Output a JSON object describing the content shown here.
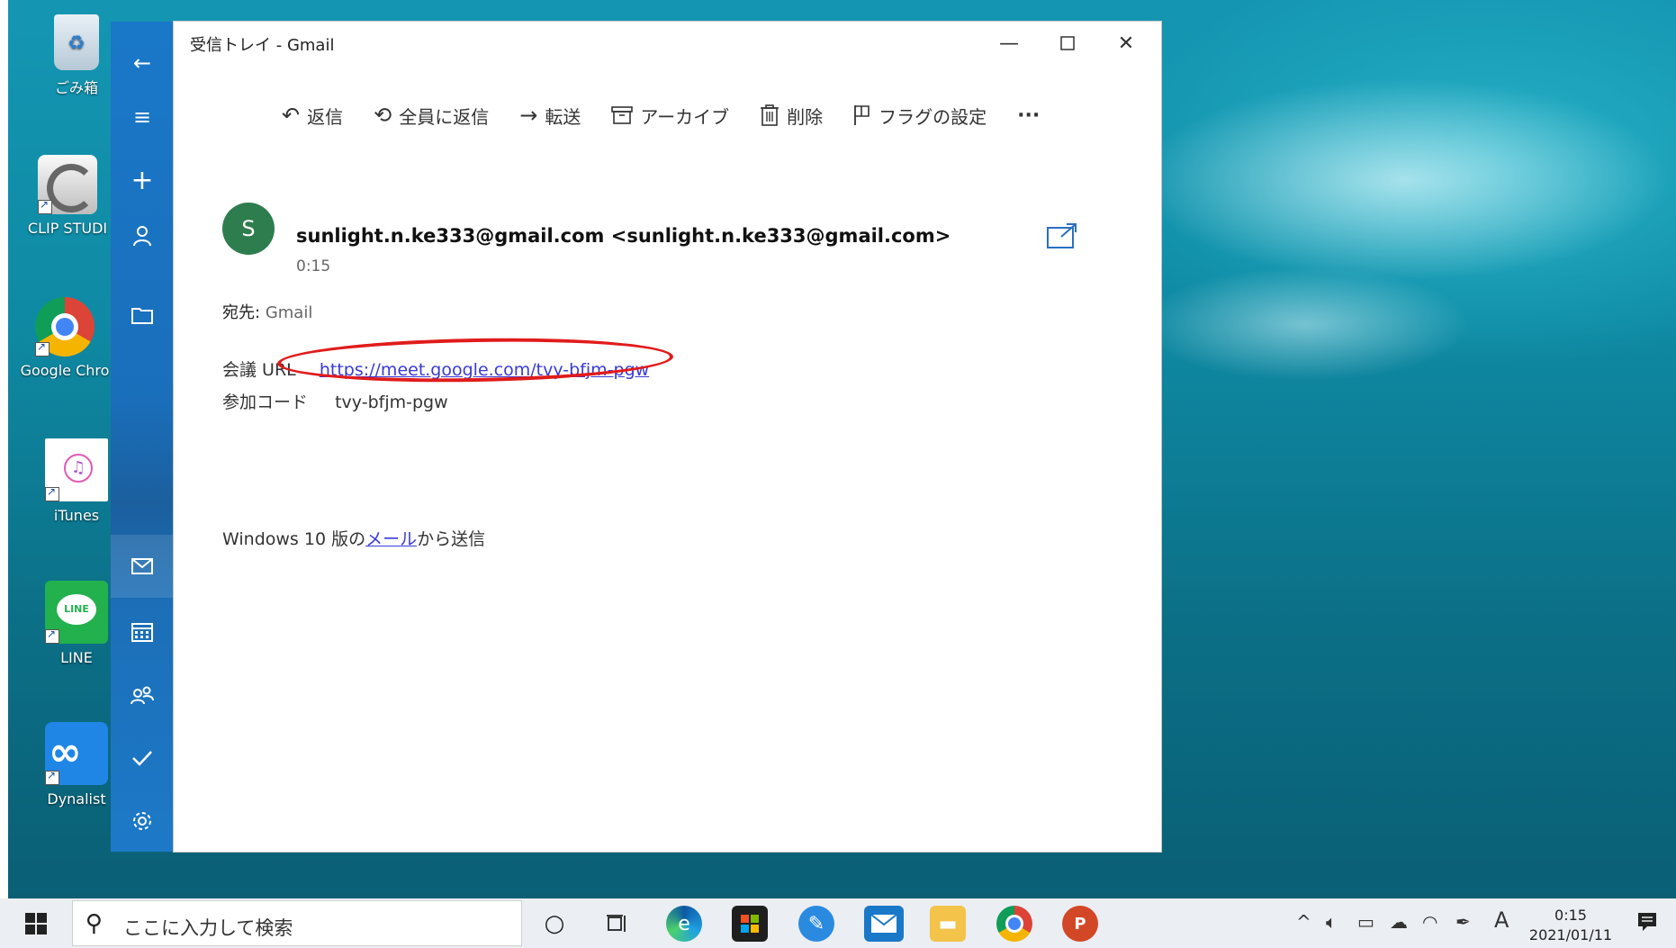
{
  "desktop": {
    "icons": [
      {
        "label": "ごみ箱"
      },
      {
        "label": "CLIP STUDI"
      },
      {
        "label": "Google Chro"
      },
      {
        "label": "iTunes"
      },
      {
        "label": "LINE"
      },
      {
        "label": "Dynalist"
      }
    ]
  },
  "window": {
    "title": "受信トレイ - Gmail",
    "toolbar": {
      "reply": "返信",
      "reply_all": "全員に返信",
      "forward": "転送",
      "archive": "アーカイブ",
      "delete": "削除",
      "flag": "フラグの設定",
      "more": "···"
    },
    "message": {
      "avatar_letter": "S",
      "sender": "sunlight.n.ke333@gmail.com <sunlight.n.ke333@gmail.com>",
      "time": "0:15",
      "to_label": "宛先:",
      "to_value": "Gmail",
      "meeting_label": "会議 URL",
      "meeting_url": "https://meet.google.com/tvy-bfjm-pgw",
      "code_label": "参加コード",
      "code_value": "tvy-bfjm-pgw",
      "footer_prefix": "Windows 10 版の",
      "footer_link": "メール",
      "footer_suffix": "から送信"
    }
  },
  "taskbar": {
    "search_placeholder": "ここに入力して検索",
    "clock_time": "0:15",
    "clock_date": "2021/01/11",
    "ime": "A"
  },
  "colors": {
    "accent": "#1a78c9",
    "avatar": "#2e7d4e",
    "annotation": "#e11b1b",
    "link": "#3a3ad6"
  }
}
